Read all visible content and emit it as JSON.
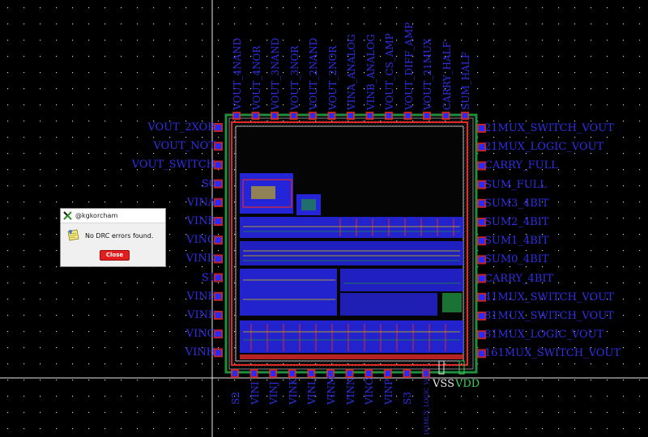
{
  "window": {
    "app_title": "@kgkorcham"
  },
  "layout": {
    "top_pins": [
      "VOUT_4NAND",
      "VOUT_4NOR",
      "VOUT_3NAND",
      "VOUT_3NOR",
      "VOUT_2NAND",
      "VOUT_2NOR",
      "VINA_ANALOG",
      "VINB_ANALOG",
      "VOUT_CS_AMP",
      "VOUT_DIFF_AMP",
      "VOUT_21MUX",
      "CARRY_HALF",
      "SUM_HALF"
    ],
    "left_pins": [
      "VOUT_2XOR",
      "VOUT_NOT",
      "VOUT_SWITCH",
      "S0",
      "VINA",
      "VINB",
      "VINC",
      "VIND",
      "S1",
      "VINE",
      "VINF",
      "VING",
      "VINH"
    ],
    "right_pins": [
      "21MUX_SWITCH_VOUT",
      "21MUX_LOGIC_VOUT",
      "CARRY_FULL",
      "SUM_FULL",
      "SUM3_4BIT",
      "SUM2_4BIT",
      "SUM1_4BIT",
      "SUM0_4BIT",
      "CARRY_4BIT",
      "41MUX_SWITCH_VOUT",
      "81MUX_SWITCH_VOUT",
      "81MUX_LOGIC_VOUT",
      "161MUX_SWITCH_VOUT"
    ],
    "bottom_pins": [
      "S2",
      "VINI",
      "VINJ",
      "VINK",
      "VINL",
      "VINM",
      "VINN",
      "VINO",
      "VINP",
      "S3",
      "161MUX_LOGIC_VOUT"
    ],
    "power_pins": {
      "vss": "VSS",
      "vdd": "VDD"
    },
    "colors": {
      "background": "#000000",
      "pin_text": "#2f2fe6",
      "metal_blue": "#2a2aff",
      "poly_red": "#e22a2a",
      "guard_green": "#1f8f3f",
      "vss": "#e8e8e8",
      "vdd": "#39d353"
    }
  },
  "dialog": {
    "title": "@kgkorcham",
    "icon": "note-icon",
    "message": "No DRC errors found.",
    "close_label": "Close"
  }
}
